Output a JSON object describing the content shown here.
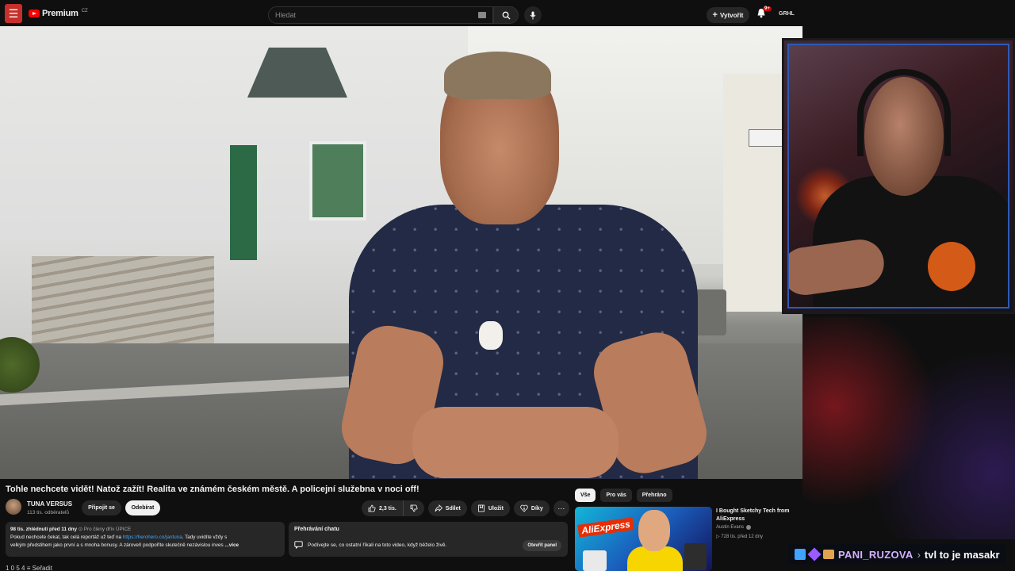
{
  "header": {
    "brand": "Premium",
    "brand_region": "CZ",
    "search_placeholder": "Hledat",
    "create_label": "Vytvořit",
    "notifications_badge": "9+",
    "avatar_text": "GRHL"
  },
  "video": {
    "title": "Tohle nechcete vidět! Natož zažít! Realita ve známém českém městě. A policejní služebna v noci off!",
    "channel_name": "TUNA VERSUS",
    "channel_subs": "113 tis. odběratelů",
    "join_label": "Připojit se",
    "unsubscribe_label": "Odebírat",
    "like_count": "2,3 tis.",
    "share_label": "Sdílet",
    "save_label": "Uložit",
    "thanks_label": "Díky"
  },
  "description": {
    "meta_views": "98 tis. zhlédnutí  před 11 dny",
    "meta_members": "Pro členy dřív  ÚPICE",
    "line1_pre": "Pokud nechcete čekat, tak celá reportáž už teď na ",
    "link": "https://herohero.co/jantuna",
    "line1_post": ". Tady uvidíte vždy s",
    "line2": "velkým předstihem jako první a s mnoha bonusy. A zároveň podpoříte skutečně nezávislou inves",
    "more": "...více"
  },
  "chat_replay": {
    "heading": "Přehrávání chatu",
    "text": "Podívejte se, co ostatní říkali na toto video, když běželo živě.",
    "open_label": "Otevřít panel"
  },
  "filters": [
    "Vše",
    "Pro vás",
    "Přehráno"
  ],
  "recommendation": {
    "thumb_text": "AliExpress",
    "title": "I Bought Sketchy Tech from AliExpress",
    "channel": "Austin Evans",
    "stats": "728 tis.  před 12 dny"
  },
  "stream_chat": {
    "username": "PANI_RUZOVA",
    "message": "tvl to je masakr"
  },
  "below_peek": "1 0 5 4        ≡ Seřadit"
}
